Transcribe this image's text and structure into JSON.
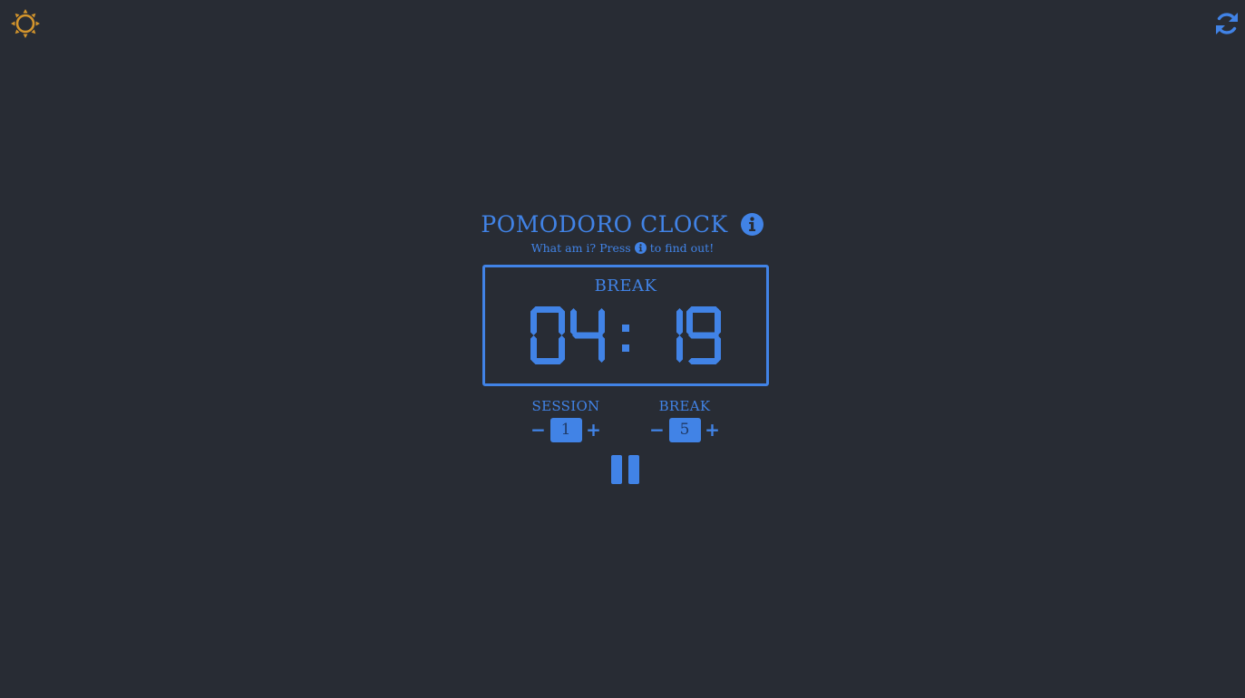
{
  "header": {
    "theme_icon": "sun-icon",
    "reset_icon": "refresh-icon",
    "theme_color": "#d4952c",
    "accent_color": "#4183e6",
    "background_color": "#282c34"
  },
  "title": {
    "text": "POMODORO CLOCK",
    "info_icon": "info-circle-icon"
  },
  "subtitle": {
    "before": "What am i? Press",
    "after": "to find out!"
  },
  "clock": {
    "mode_label": "BREAK",
    "minutes": "04",
    "seconds": "19",
    "separator": ":"
  },
  "controls": {
    "session": {
      "label": "SESSION",
      "value": "1",
      "minus": "−",
      "plus": "+"
    },
    "break": {
      "label": "BREAK",
      "value": "5",
      "minus": "−",
      "plus": "+"
    }
  },
  "playback": {
    "state_icon": "pause-icon"
  }
}
